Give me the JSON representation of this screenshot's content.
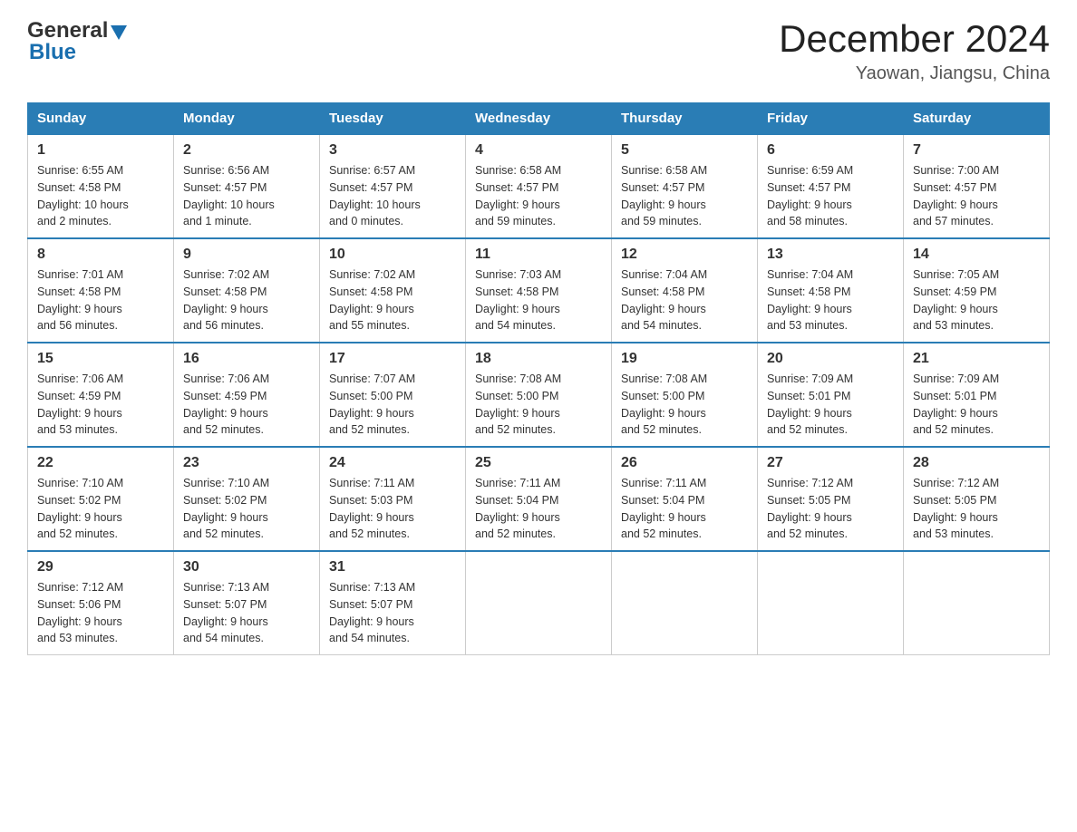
{
  "header": {
    "logo_general": "General",
    "logo_blue": "Blue",
    "month_year": "December 2024",
    "location": "Yaowan, Jiangsu, China"
  },
  "days_of_week": [
    "Sunday",
    "Monday",
    "Tuesday",
    "Wednesday",
    "Thursday",
    "Friday",
    "Saturday"
  ],
  "weeks": [
    [
      {
        "day": "1",
        "sunrise": "6:55 AM",
        "sunset": "4:58 PM",
        "daylight": "10 hours and 2 minutes."
      },
      {
        "day": "2",
        "sunrise": "6:56 AM",
        "sunset": "4:57 PM",
        "daylight": "10 hours and 1 minute."
      },
      {
        "day": "3",
        "sunrise": "6:57 AM",
        "sunset": "4:57 PM",
        "daylight": "10 hours and 0 minutes."
      },
      {
        "day": "4",
        "sunrise": "6:58 AM",
        "sunset": "4:57 PM",
        "daylight": "9 hours and 59 minutes."
      },
      {
        "day": "5",
        "sunrise": "6:58 AM",
        "sunset": "4:57 PM",
        "daylight": "9 hours and 59 minutes."
      },
      {
        "day": "6",
        "sunrise": "6:59 AM",
        "sunset": "4:57 PM",
        "daylight": "9 hours and 58 minutes."
      },
      {
        "day": "7",
        "sunrise": "7:00 AM",
        "sunset": "4:57 PM",
        "daylight": "9 hours and 57 minutes."
      }
    ],
    [
      {
        "day": "8",
        "sunrise": "7:01 AM",
        "sunset": "4:58 PM",
        "daylight": "9 hours and 56 minutes."
      },
      {
        "day": "9",
        "sunrise": "7:02 AM",
        "sunset": "4:58 PM",
        "daylight": "9 hours and 56 minutes."
      },
      {
        "day": "10",
        "sunrise": "7:02 AM",
        "sunset": "4:58 PM",
        "daylight": "9 hours and 55 minutes."
      },
      {
        "day": "11",
        "sunrise": "7:03 AM",
        "sunset": "4:58 PM",
        "daylight": "9 hours and 54 minutes."
      },
      {
        "day": "12",
        "sunrise": "7:04 AM",
        "sunset": "4:58 PM",
        "daylight": "9 hours and 54 minutes."
      },
      {
        "day": "13",
        "sunrise": "7:04 AM",
        "sunset": "4:58 PM",
        "daylight": "9 hours and 53 minutes."
      },
      {
        "day": "14",
        "sunrise": "7:05 AM",
        "sunset": "4:59 PM",
        "daylight": "9 hours and 53 minutes."
      }
    ],
    [
      {
        "day": "15",
        "sunrise": "7:06 AM",
        "sunset": "4:59 PM",
        "daylight": "9 hours and 53 minutes."
      },
      {
        "day": "16",
        "sunrise": "7:06 AM",
        "sunset": "4:59 PM",
        "daylight": "9 hours and 52 minutes."
      },
      {
        "day": "17",
        "sunrise": "7:07 AM",
        "sunset": "5:00 PM",
        "daylight": "9 hours and 52 minutes."
      },
      {
        "day": "18",
        "sunrise": "7:08 AM",
        "sunset": "5:00 PM",
        "daylight": "9 hours and 52 minutes."
      },
      {
        "day": "19",
        "sunrise": "7:08 AM",
        "sunset": "5:00 PM",
        "daylight": "9 hours and 52 minutes."
      },
      {
        "day": "20",
        "sunrise": "7:09 AM",
        "sunset": "5:01 PM",
        "daylight": "9 hours and 52 minutes."
      },
      {
        "day": "21",
        "sunrise": "7:09 AM",
        "sunset": "5:01 PM",
        "daylight": "9 hours and 52 minutes."
      }
    ],
    [
      {
        "day": "22",
        "sunrise": "7:10 AM",
        "sunset": "5:02 PM",
        "daylight": "9 hours and 52 minutes."
      },
      {
        "day": "23",
        "sunrise": "7:10 AM",
        "sunset": "5:02 PM",
        "daylight": "9 hours and 52 minutes."
      },
      {
        "day": "24",
        "sunrise": "7:11 AM",
        "sunset": "5:03 PM",
        "daylight": "9 hours and 52 minutes."
      },
      {
        "day": "25",
        "sunrise": "7:11 AM",
        "sunset": "5:04 PM",
        "daylight": "9 hours and 52 minutes."
      },
      {
        "day": "26",
        "sunrise": "7:11 AM",
        "sunset": "5:04 PM",
        "daylight": "9 hours and 52 minutes."
      },
      {
        "day": "27",
        "sunrise": "7:12 AM",
        "sunset": "5:05 PM",
        "daylight": "9 hours and 52 minutes."
      },
      {
        "day": "28",
        "sunrise": "7:12 AM",
        "sunset": "5:05 PM",
        "daylight": "9 hours and 53 minutes."
      }
    ],
    [
      {
        "day": "29",
        "sunrise": "7:12 AM",
        "sunset": "5:06 PM",
        "daylight": "9 hours and 53 minutes."
      },
      {
        "day": "30",
        "sunrise": "7:13 AM",
        "sunset": "5:07 PM",
        "daylight": "9 hours and 54 minutes."
      },
      {
        "day": "31",
        "sunrise": "7:13 AM",
        "sunset": "5:07 PM",
        "daylight": "9 hours and 54 minutes."
      },
      null,
      null,
      null,
      null
    ]
  ],
  "labels": {
    "sunrise": "Sunrise:",
    "sunset": "Sunset:",
    "daylight": "Daylight:"
  }
}
